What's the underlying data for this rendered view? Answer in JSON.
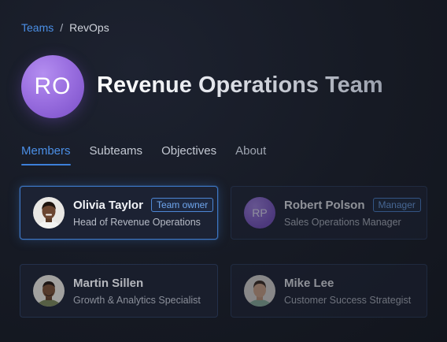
{
  "breadcrumb": {
    "link": "Teams",
    "separator": "/",
    "current": "RevOps"
  },
  "team": {
    "initials": "RO",
    "name": "Revenue Operations Team"
  },
  "tabs": [
    {
      "label": "Members",
      "active": true
    },
    {
      "label": "Subteams"
    },
    {
      "label": "Objectives"
    },
    {
      "label": "About"
    }
  ],
  "members": [
    {
      "name": "Olivia Taylor",
      "role": "Head of Revenue Operations",
      "badge": "Team owner",
      "avatar": "photo"
    },
    {
      "name": "Robert Polson",
      "role": "Sales Operations Manager",
      "badge": "Manager",
      "avatar_initials": "RP"
    },
    {
      "name": "Martin Sillen",
      "role": "Growth & Analytics Specialist",
      "avatar": "photo"
    },
    {
      "name": "Mike Lee",
      "role": "Customer Success Strategist",
      "avatar": "photo"
    }
  ],
  "colors": {
    "accent": "#4b8fe6",
    "background": "#161a24",
    "avatar_purple": "#9a6fe0"
  }
}
